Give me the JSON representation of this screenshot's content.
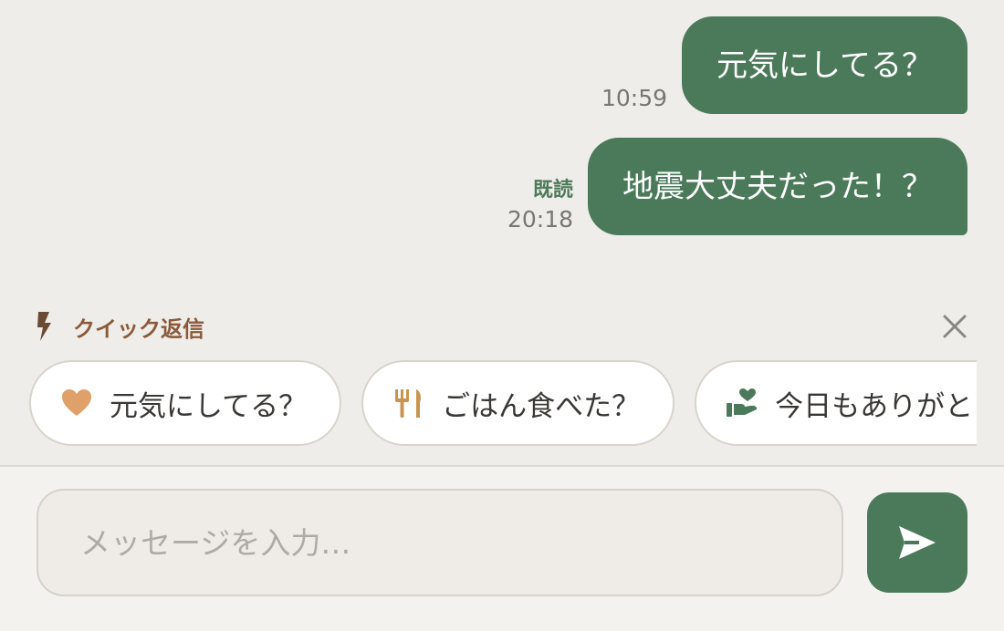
{
  "messages": [
    {
      "text": "元気にしてる？",
      "time": "10:59",
      "read_label": ""
    },
    {
      "text": "地震大丈夫だった！？",
      "time": "20:18",
      "read_label": "既読"
    }
  ],
  "quick_reply": {
    "title": "クイック返信",
    "chips": [
      {
        "icon": "heart-icon",
        "label": "元気にしてる？"
      },
      {
        "icon": "fork-knife-icon",
        "label": "ごはん食べた？"
      },
      {
        "icon": "hand-heart-icon",
        "label": "今日もありがとう"
      }
    ]
  },
  "composer": {
    "placeholder": "メッセージを入力…"
  },
  "colors": {
    "accent": "#4b7a5a",
    "background": "#efede9",
    "quick_title": "#8a5a3a"
  }
}
